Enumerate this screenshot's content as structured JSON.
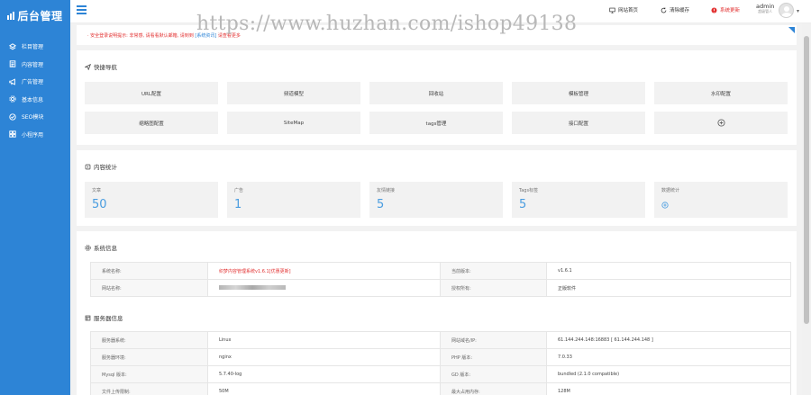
{
  "app": {
    "logo_text": "后台管理",
    "watermark": "https://www.huzhan.com/ishop49138"
  },
  "colors": {
    "accent": "#2d84d6",
    "stat_value": "#4a9de0",
    "warning": "#e23030"
  },
  "sidebar": {
    "items": [
      {
        "label": "栏目管理",
        "icon": "layers-icon"
      },
      {
        "label": "内容管理",
        "icon": "document-icon"
      },
      {
        "label": "广告管理",
        "icon": "megaphone-icon"
      },
      {
        "label": "基本信息",
        "icon": "gear-icon"
      },
      {
        "label": "SEO模块",
        "icon": "seo-icon"
      },
      {
        "label": "小程序用",
        "icon": "grid-icon"
      }
    ]
  },
  "topbar": {
    "home_label": "网站首页",
    "clear_cache_label": "清除缓存",
    "update_label": "系统更新",
    "user_name": "admin",
    "user_role": "超级管人"
  },
  "notice": {
    "text": "· 安全登录说明提示: 非常感, 请看看默认邮箱, 请到到",
    "link_text": "[系统资讯]",
    "tail": "请查看更多"
  },
  "quick_nav": {
    "title": "快捷导航",
    "items": [
      "URL配置",
      "频道模型",
      "回收站",
      "模板管理",
      "水印配置",
      "缩略图配置",
      "SiteMap",
      "tags管理",
      "接口配置"
    ],
    "add_icon": "plus-circle-icon"
  },
  "stats": {
    "title": "内容统计",
    "items": [
      {
        "label": "文章",
        "value": "50"
      },
      {
        "label": "广告",
        "value": "1"
      },
      {
        "label": "友情链接",
        "value": "5"
      },
      {
        "label": "Tags标签",
        "value": "5"
      },
      {
        "label": "数据统计",
        "value": ""
      }
    ]
  },
  "system": {
    "title": "系统信息",
    "rows": [
      {
        "k1": "系统名称:",
        "v1": "织梦内容管理系统v1.6.1[优惠更新]",
        "k2": "当前版本:",
        "v2": "v1.6.1"
      },
      {
        "k1": "网站名称:",
        "v1": "",
        "k2": "授权所有:",
        "v2": "正版软件"
      }
    ]
  },
  "server": {
    "title": "服务器信息",
    "rows": [
      {
        "k1": "服务器系统:",
        "v1": "Linux",
        "k2": "网站域名/IP:",
        "v2": "61.144.244.148:16883 [ 61.144.244.148 ]"
      },
      {
        "k1": "服务器环境:",
        "v1": "nginx",
        "k2": "PHP 版本:",
        "v2": "7.0.33"
      },
      {
        "k1": "Mysql 版本:",
        "v1": "5.7.40-log",
        "k2": "GD 版本:",
        "v2": "bundled (2.1.0 compatible)"
      },
      {
        "k1": "文件上传限制:",
        "v1": "50M",
        "k2": "最大占用内存:",
        "v2": "128M"
      }
    ]
  }
}
